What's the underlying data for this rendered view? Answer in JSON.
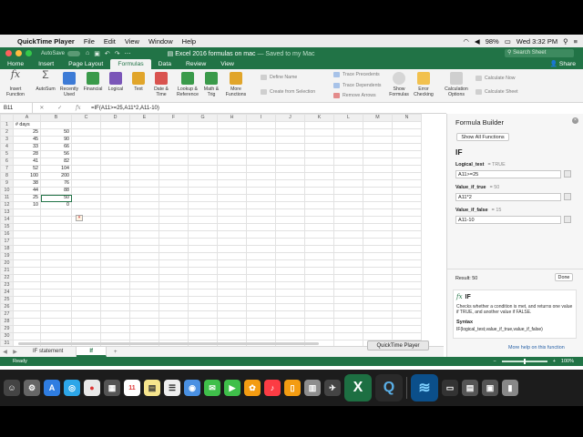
{
  "menubar": {
    "app_name": "QuickTime Player",
    "items": [
      "File",
      "Edit",
      "View",
      "Window",
      "Help"
    ],
    "battery": "98%",
    "clock": "Wed 3:32 PM"
  },
  "title": {
    "autosave": "AutoSave",
    "document": "Excel 2016 formulas on mac",
    "saved": "— Saved to my Mac",
    "search_placeholder": "Search Sheet"
  },
  "ribbon_tabs": [
    "Home",
    "Insert",
    "Page Layout",
    "Formulas",
    "Data",
    "Review",
    "View"
  ],
  "active_ribbon_tab": "Formulas",
  "share_label": "Share",
  "ribbon": {
    "big_buttons": [
      {
        "label": "Insert Function",
        "color": "#7a7a7a"
      },
      {
        "label": "AutoSum",
        "color": "#6b6b6b"
      },
      {
        "label": "Recently Used",
        "color": "#3d7bd6"
      },
      {
        "label": "Financial",
        "color": "#3a9a4a"
      },
      {
        "label": "Logical",
        "color": "#7a55b8"
      },
      {
        "label": "Text",
        "color": "#e1a52a"
      },
      {
        "label": "Date & Time",
        "color": "#d9534f"
      },
      {
        "label": "Lookup & Reference",
        "color": "#3a9a4a"
      },
      {
        "label": "Math & Trig",
        "color": "#3a9a4a"
      },
      {
        "label": "More Functions",
        "color": "#e1a52a"
      }
    ],
    "names": [
      "Define Name",
      "Create from Selection"
    ],
    "audit": [
      "Trace Precedents",
      "Trace Dependents",
      "Remove Arrows"
    ],
    "show_formulas": "Show Formulas",
    "error_checking": "Error Checking",
    "calc_options": "Calculation Options",
    "calc": [
      "Calculate Now",
      "Calculate Sheet"
    ]
  },
  "formula_bar": {
    "name_box": "B11",
    "formula": "=IF(A11>=25,A11*2,A11-10)"
  },
  "sheet": {
    "columns": [
      "A",
      "B",
      "C",
      "D",
      "E",
      "F",
      "G",
      "H",
      "I",
      "J",
      "K",
      "L",
      "M",
      "N"
    ],
    "rows": [
      [
        "# days",
        ""
      ],
      [
        "25",
        "50"
      ],
      [
        "45",
        "90"
      ],
      [
        "33",
        "66"
      ],
      [
        "28",
        "56"
      ],
      [
        "41",
        "82"
      ],
      [
        "52",
        "104"
      ],
      [
        "100",
        "200"
      ],
      [
        "38",
        "76"
      ],
      [
        "44",
        "88"
      ],
      [
        "25",
        "50"
      ],
      [
        "10",
        "0"
      ]
    ],
    "selected_row": 11,
    "total_rows": 31
  },
  "sheet_tabs": [
    "IF statement",
    "If"
  ],
  "active_sheet": "If",
  "status": {
    "text": "Ready",
    "zoom": "100%"
  },
  "formula_builder": {
    "title": "Formula Builder",
    "show_all": "Show All Functions",
    "function_name": "IF",
    "args": [
      {
        "name": "Logical_test",
        "value_hint": "TRUE",
        "input": "A11>=25"
      },
      {
        "name": "Value_if_true",
        "value_hint": "50",
        "input": "A11*2"
      },
      {
        "name": "Value_if_false",
        "value_hint": "15",
        "input": "A11-10"
      }
    ],
    "result": "Result: 50",
    "done": "Done",
    "help_fn": "IF",
    "help_desc": "Checks whether a condition is met, and returns one value if TRUE, and another value if FALSE.",
    "syntax_label": "Syntax",
    "syntax": "IF(logical_test,value_if_true,value_if_false)",
    "more_help": "More help on this function"
  },
  "tooltip": "QuickTime Player"
}
